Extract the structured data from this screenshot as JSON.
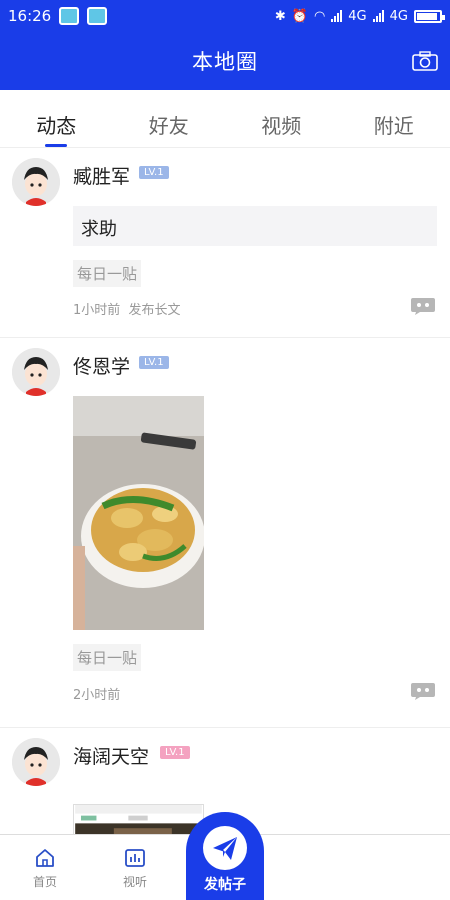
{
  "status_bar": {
    "time": "16:26",
    "net1": "4G",
    "net2": "4G"
  },
  "header": {
    "title": "本地圈",
    "camera_icon": "camera-icon"
  },
  "tabs": [
    {
      "label": "动态",
      "active": true
    },
    {
      "label": "好友",
      "active": false
    },
    {
      "label": "视频",
      "active": false
    },
    {
      "label": "附近",
      "active": false
    }
  ],
  "posts": [
    {
      "username": "臧胜军",
      "level": "LV.1",
      "content": "求助",
      "tag": "每日一贴",
      "time": "1小时前",
      "extra": "发布长文"
    },
    {
      "username": "佟恩学",
      "level": "LV.1",
      "tag": "每日一贴",
      "time": "2小时前"
    },
    {
      "username": "海阔天空",
      "level": "LV.1"
    }
  ],
  "bottom_nav": {
    "home": "首页",
    "video": "视听",
    "post": "发帖子"
  },
  "colors": {
    "brand_blue": "#1a3de8",
    "level_blue": "#9bb6e8",
    "level_pink": "#f4a2c0"
  }
}
